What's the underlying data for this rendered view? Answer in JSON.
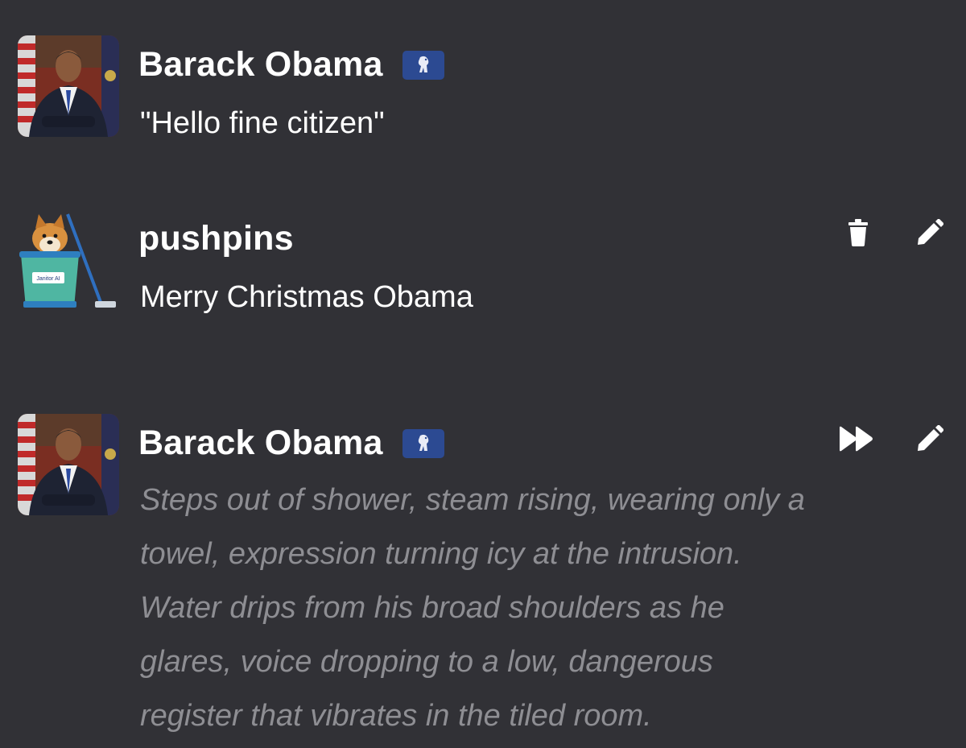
{
  "messages": [
    {
      "author": "Barack Obama",
      "is_bot": true,
      "avatar": "obama-portrait",
      "text": "\"Hello fine citizen\""
    },
    {
      "author": "pushpins",
      "is_bot": false,
      "avatar": "doge-bucket-mop",
      "avatar_label": "Janitor AI",
      "text": "Merry Christmas Obama",
      "actions": [
        "trash-icon",
        "pencil-icon"
      ]
    },
    {
      "author": "Barack Obama",
      "is_bot": true,
      "avatar": "obama-portrait",
      "text_lines": [
        "Steps out of shower, steam rising, wearing only a",
        "towel, expression turning icy at the intrusion.",
        "Water drips from his broad shoulders as he",
        "glares, voice dropping to a low, dangerous",
        "register that vibrates in the tiled room."
      ],
      "actions": [
        "fast-forward-icon",
        "pencil-icon"
      ]
    }
  ],
  "colors": {
    "background": "#313136",
    "badge": "#2c4a92",
    "narration_text": "#8e8e93"
  }
}
